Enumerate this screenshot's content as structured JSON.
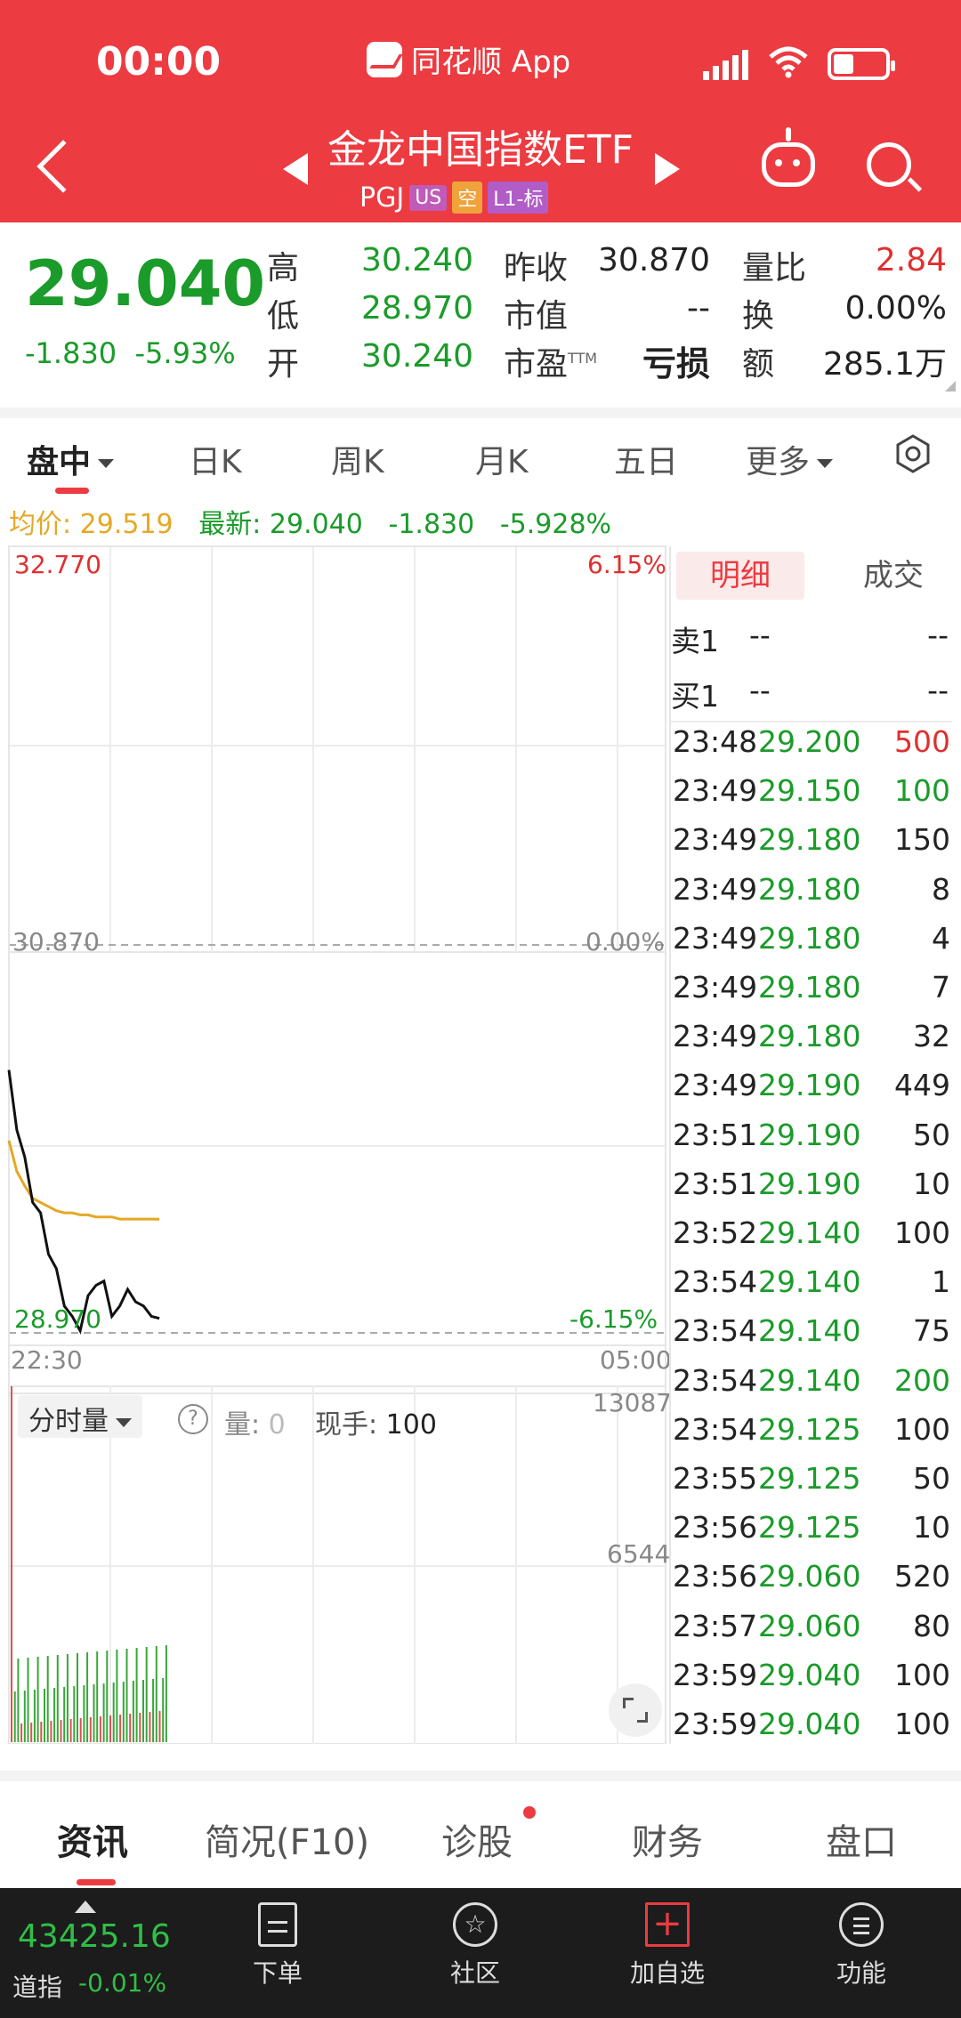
{
  "status_bar": {
    "time": "00:00",
    "app_name": "同花顺 App"
  },
  "header": {
    "title": "金龙中国指数ETF",
    "code": "PGJ",
    "tags": [
      "US",
      "空",
      "L1-标"
    ]
  },
  "quote": {
    "price": "29.040",
    "change": "-1.830",
    "change_pct": "-5.93%",
    "labels": {
      "high": "高",
      "low": "低",
      "open": "开",
      "prev_close": "昨收",
      "mkt_cap": "市值",
      "pe": "市盈",
      "pe_sup": "TTM",
      "vol_ratio": "量比",
      "turnover": "换",
      "amount": "额"
    },
    "values": {
      "high": "30.240",
      "low": "28.970",
      "open": "30.240",
      "prev_close": "30.870",
      "mkt_cap": "--",
      "pe": "亏损",
      "vol_ratio": "2.84",
      "turnover": "0.00%",
      "amount": "285.1万"
    }
  },
  "tabs": [
    "盘中",
    "日K",
    "周K",
    "月K",
    "五日",
    "更多"
  ],
  "legend": {
    "avg_label": "均价:",
    "avg": "29.519",
    "last_label": "最新:",
    "last": "29.040",
    "chg": "-1.830",
    "chg_pct": "-5.928%"
  },
  "chart_data": {
    "type": "line",
    "x_range": [
      "22:30",
      "05:00"
    ],
    "y_labels": {
      "top": "32.770",
      "mid": "30.870",
      "bottom": "28.970"
    },
    "pct_labels": {
      "top": "6.15%",
      "mid": "0.00%",
      "bottom": "-6.15%"
    },
    "ylim": [
      28.97,
      32.77
    ],
    "price_series": [
      30.24,
      29.95,
      29.82,
      29.6,
      29.55,
      29.35,
      29.28,
      29.1,
      29.05,
      28.98,
      29.15,
      29.2,
      29.22,
      29.05,
      29.1,
      29.18,
      29.12,
      29.1,
      29.05,
      29.04
    ],
    "avg_series": [
      29.9,
      29.75,
      29.68,
      29.62,
      29.6,
      29.58,
      29.56,
      29.55,
      29.55,
      29.54,
      29.54,
      29.53,
      29.53,
      29.53,
      29.52,
      29.52,
      29.52,
      29.52,
      29.52,
      29.519
    ],
    "volume": {
      "max_label": "13087",
      "mid_label": "6544"
    }
  },
  "volume_panel": {
    "selector": "分时量",
    "qty_label": "量:",
    "qty": "0",
    "hand_label": "现手:",
    "hand": "100"
  },
  "trade_panel": {
    "tabs": [
      "明细",
      "成交"
    ],
    "sell1": {
      "label": "卖1",
      "price": "--",
      "vol": "--"
    },
    "buy1": {
      "label": "买1",
      "price": "--",
      "vol": "--"
    },
    "rows": [
      {
        "time": "23:48",
        "price": "29.200",
        "vol": "500",
        "color": "#e02f2f"
      },
      {
        "time": "23:49",
        "price": "29.150",
        "vol": "100",
        "color": "#1a9b2a"
      },
      {
        "time": "23:49",
        "price": "29.180",
        "vol": "150",
        "color": "#222222"
      },
      {
        "time": "23:49",
        "price": "29.180",
        "vol": "8",
        "color": "#222222"
      },
      {
        "time": "23:49",
        "price": "29.180",
        "vol": "4",
        "color": "#222222"
      },
      {
        "time": "23:49",
        "price": "29.180",
        "vol": "7",
        "color": "#222222"
      },
      {
        "time": "23:49",
        "price": "29.180",
        "vol": "32",
        "color": "#222222"
      },
      {
        "time": "23:49",
        "price": "29.190",
        "vol": "449",
        "color": "#222222"
      },
      {
        "time": "23:51",
        "price": "29.190",
        "vol": "50",
        "color": "#222222"
      },
      {
        "time": "23:51",
        "price": "29.190",
        "vol": "10",
        "color": "#222222"
      },
      {
        "time": "23:52",
        "price": "29.140",
        "vol": "100",
        "color": "#222222"
      },
      {
        "time": "23:54",
        "price": "29.140",
        "vol": "1",
        "color": "#222222"
      },
      {
        "time": "23:54",
        "price": "29.140",
        "vol": "75",
        "color": "#222222"
      },
      {
        "time": "23:54",
        "price": "29.140",
        "vol": "200",
        "color": "#1a9b2a"
      },
      {
        "time": "23:54",
        "price": "29.125",
        "vol": "100",
        "color": "#222222"
      },
      {
        "time": "23:55",
        "price": "29.125",
        "vol": "50",
        "color": "#222222"
      },
      {
        "time": "23:56",
        "price": "29.125",
        "vol": "10",
        "color": "#222222"
      },
      {
        "time": "23:56",
        "price": "29.060",
        "vol": "520",
        "color": "#222222"
      },
      {
        "time": "23:57",
        "price": "29.060",
        "vol": "80",
        "color": "#222222"
      },
      {
        "time": "23:59",
        "price": "29.040",
        "vol": "100",
        "color": "#222222"
      },
      {
        "time": "23:59",
        "price": "29.040",
        "vol": "100",
        "color": "#222222"
      }
    ]
  },
  "bottom_tabs": [
    "资讯",
    "简况(F10)",
    "诊股",
    "财务",
    "盘口"
  ],
  "bottom_bar": {
    "index_value": "43425.16",
    "index_name": "道指",
    "index_chg": "-0.01%",
    "items": [
      "下单",
      "社区",
      "加自选",
      "功能"
    ]
  }
}
